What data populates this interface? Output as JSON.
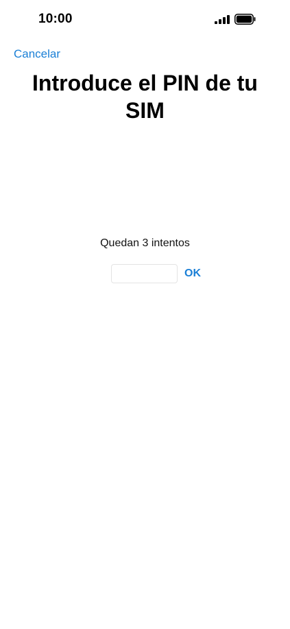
{
  "status_bar": {
    "time": "10:00",
    "signal_icon": "cellular-signal-icon",
    "battery_icon": "battery-icon"
  },
  "header": {
    "cancel_label": "Cancelar",
    "title": "Introduce el PIN de tu SIM"
  },
  "form": {
    "attempts_text": "Quedan 3 intentos",
    "pin_value": "",
    "ok_label": "OK"
  },
  "colors": {
    "accent": "#1a7fd6",
    "text": "#000000",
    "background": "#ffffff"
  }
}
